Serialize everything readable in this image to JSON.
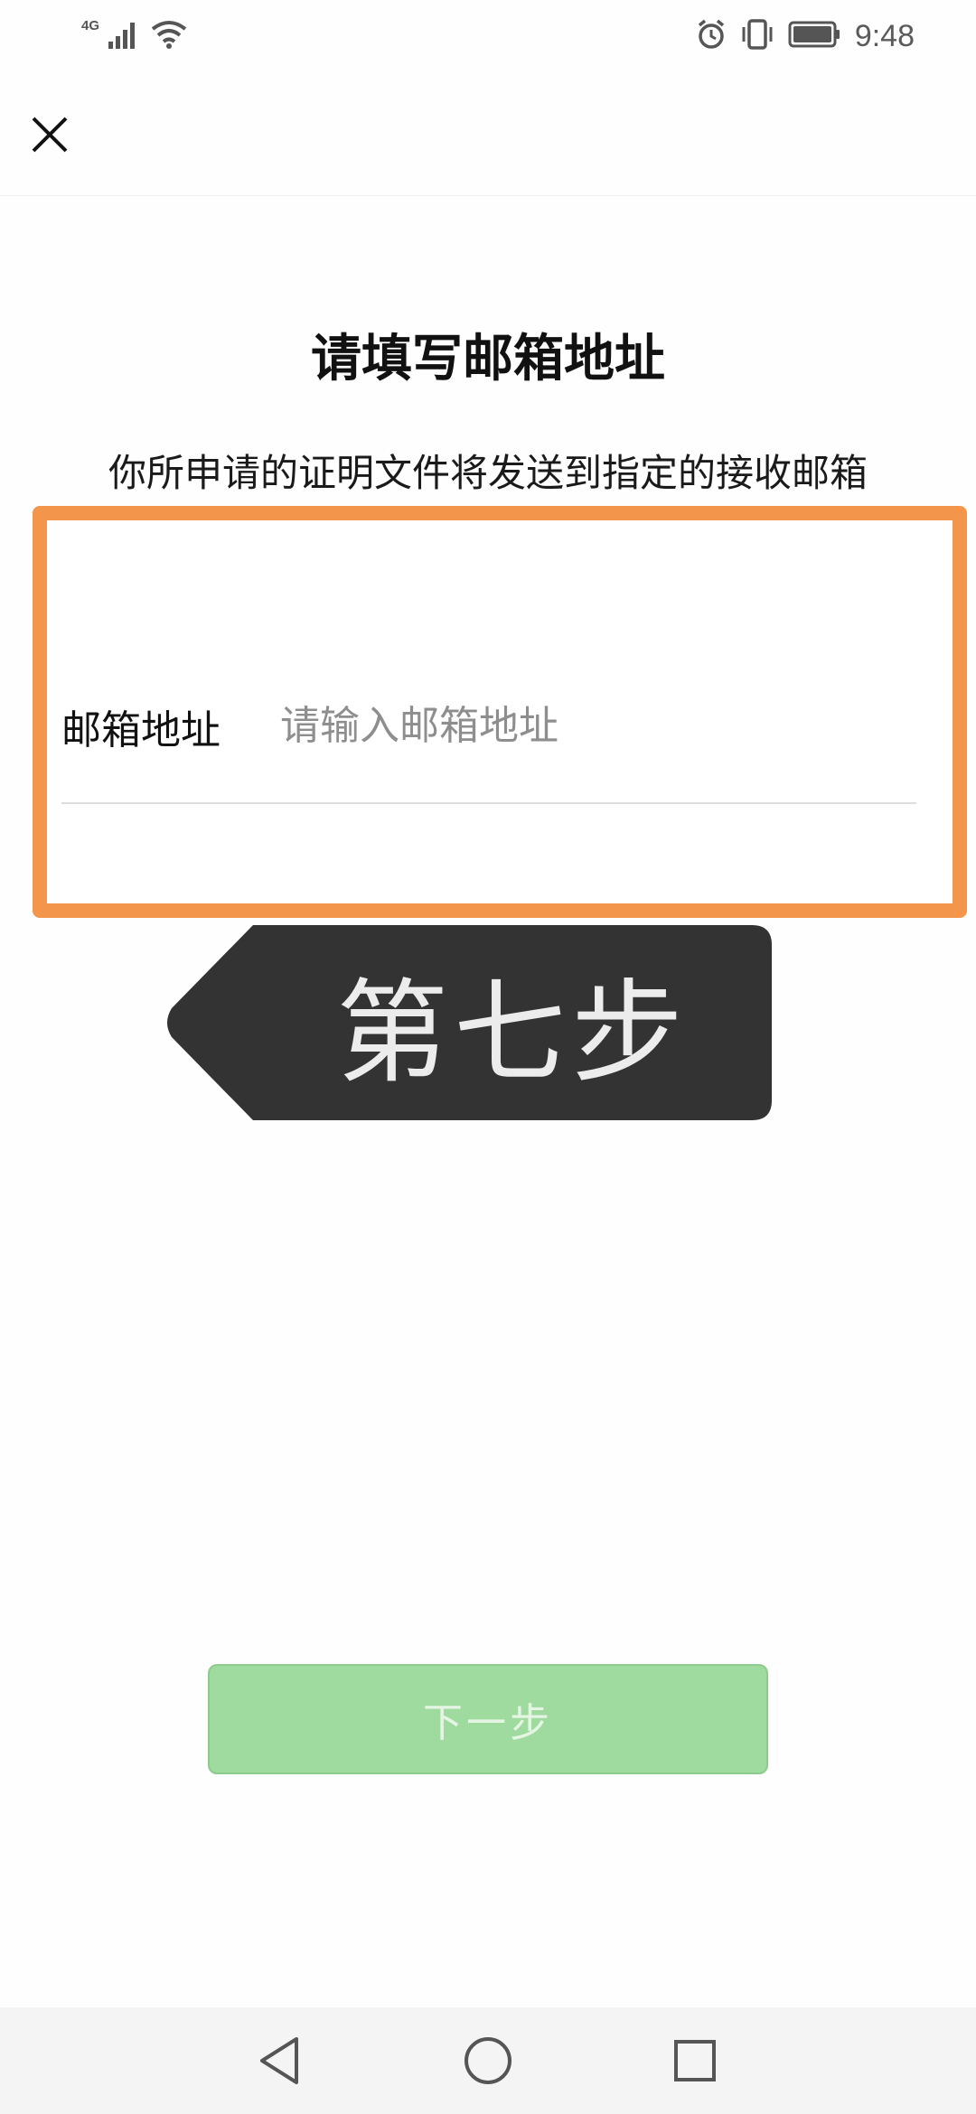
{
  "status_bar": {
    "network": "4G",
    "time": "9:48",
    "icons": [
      "signal-icon",
      "wifi-icon",
      "alarm-icon",
      "vibrate-icon",
      "battery-icon"
    ]
  },
  "header": {
    "close_icon": "close-icon"
  },
  "main": {
    "title": "请填写邮箱地址",
    "subtitle": "你所申请的证明文件将发送到指定的接收邮箱",
    "email_field": {
      "label": "邮箱地址",
      "placeholder": "请输入邮箱地址",
      "value": ""
    },
    "step_tag": "第七步",
    "next_button": "下一步"
  },
  "nav_bar": {
    "icons": [
      "back-icon",
      "home-icon",
      "recents-icon"
    ]
  },
  "colors": {
    "highlight_border": "#f3954a",
    "next_button_bg": "#9fda9e",
    "step_tag_bg": "#333333"
  }
}
